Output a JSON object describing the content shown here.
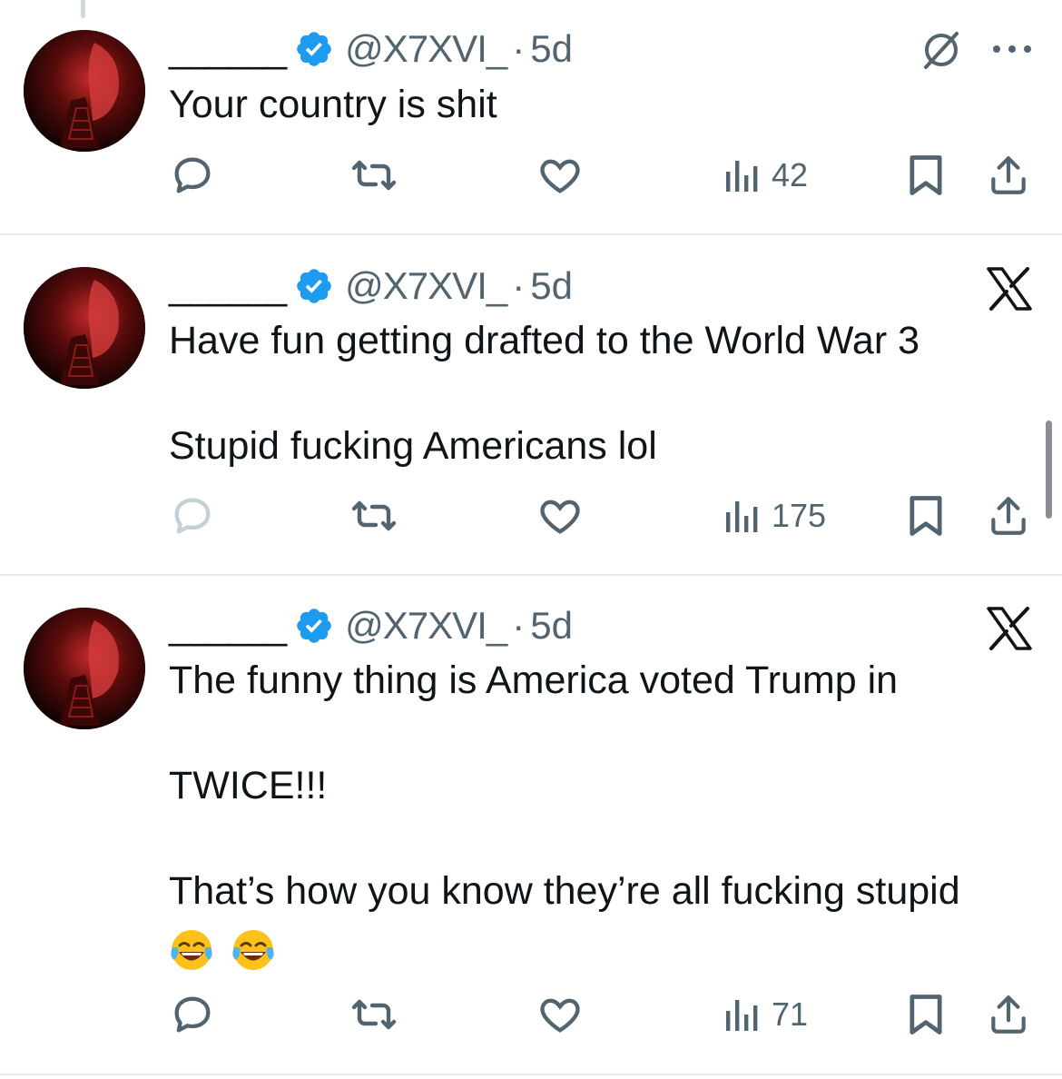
{
  "tweets": [
    {
      "display_name": "______",
      "handle": "@X7XVI_",
      "separator": "·",
      "time": "5d",
      "corner_icon": "grok-icon",
      "text_lines": [
        "Your country is shit"
      ],
      "actions": {
        "reply_count": "",
        "retweet_count": "",
        "like_count": "",
        "views": "42"
      }
    },
    {
      "display_name": "______",
      "handle": "@X7XVI_",
      "separator": "·",
      "time": "5d",
      "corner_icon": "x-logo-icon",
      "text_lines": [
        "Have fun getting drafted to the World War 3",
        "",
        "Stupid fucking Americans lol"
      ],
      "actions": {
        "reply_count": "",
        "retweet_count": "",
        "like_count": "",
        "views": "175"
      }
    },
    {
      "display_name": "______",
      "handle": "@X7XVI_",
      "separator": "·",
      "time": "5d",
      "corner_icon": "x-logo-icon",
      "text_lines": [
        "The funny thing is America voted Trump in",
        "",
        "TWICE!!!",
        "",
        "That’s how you know they’re all fucking stupid"
      ],
      "emoji": [
        "face-with-tears-of-joy",
        "face-with-tears-of-joy"
      ],
      "actions": {
        "reply_count": "",
        "retweet_count": "",
        "like_count": "",
        "views": "71"
      }
    }
  ],
  "colors": {
    "text": "#0f1419",
    "secondary": "#536471",
    "verified": "#1d9bf0",
    "divider": "#e6e9ec"
  }
}
